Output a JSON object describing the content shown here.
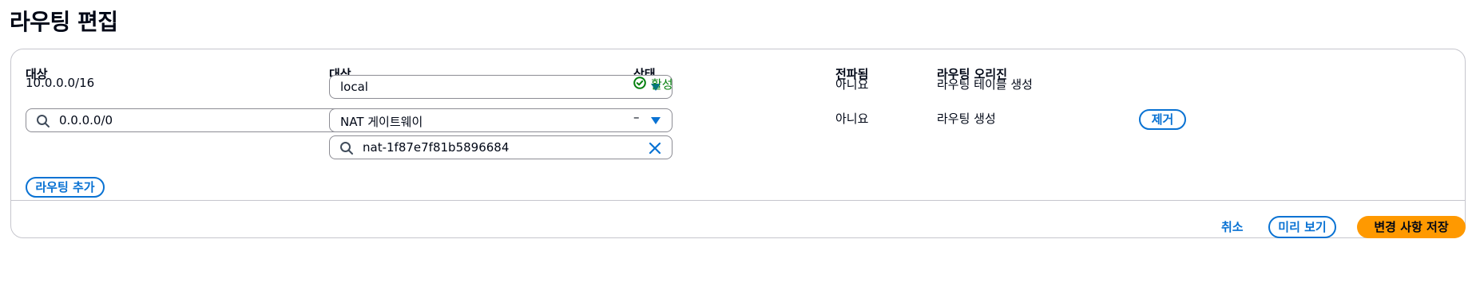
{
  "page": {
    "title": "라우팅 편집"
  },
  "table": {
    "headers": {
      "destination": "대상",
      "target": "대상",
      "status": "상태",
      "propagated": "전파됨",
      "origin": "라우팅 오리진"
    },
    "rows": [
      {
        "destination": "10.0.0.0/16",
        "target_select": "local",
        "status": "활성",
        "propagated": "아니요",
        "origin": "라우팅 테이블 생성"
      },
      {
        "destination_input": "0.0.0.0/0",
        "target_select": "NAT 게이트웨이",
        "target_search": "nat-1f87e7f81b5896684",
        "status": "–",
        "propagated": "아니요",
        "origin": "라우팅 생성",
        "remove_label": "제거"
      }
    ]
  },
  "actions": {
    "add_route": "라우팅 추가",
    "cancel": "취소",
    "preview": "미리 보기",
    "save": "변경 사항 저장"
  },
  "colors": {
    "accent": "#0972d3",
    "primary": "#ff9900",
    "success": "#037f0c"
  },
  "icons": [
    "search-icon",
    "clear-icon",
    "caret-down-icon",
    "success-check-icon"
  ]
}
